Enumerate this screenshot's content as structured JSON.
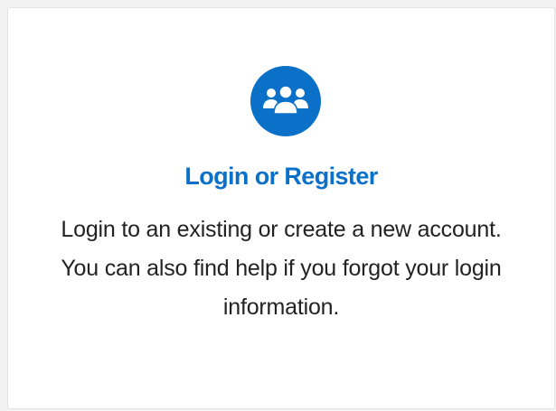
{
  "card": {
    "icon": "users-group-icon",
    "title": "Login or Register",
    "description": "Login to an existing or create a new account. You can also find help if you forgot your login information."
  },
  "colors": {
    "accent": "#0a70c8",
    "text": "#222222",
    "background": "#ffffff"
  }
}
